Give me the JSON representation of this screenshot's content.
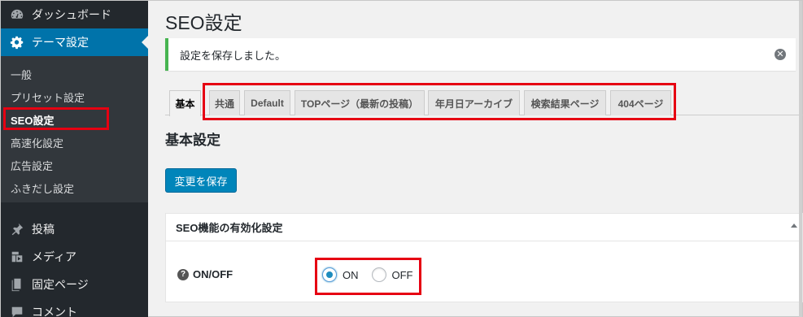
{
  "sidebar": {
    "top_items": [
      {
        "label": "ダッシュボード",
        "icon": "dashboard-icon"
      },
      {
        "label": "テーマ設定",
        "icon": "gear-icon"
      },
      {
        "label": "投稿",
        "icon": "pin-icon"
      },
      {
        "label": "メディア",
        "icon": "media-icon"
      },
      {
        "label": "固定ページ",
        "icon": "page-icon"
      },
      {
        "label": "コメント",
        "icon": "comment-icon"
      }
    ],
    "submenu": [
      "一般",
      "プリセット設定",
      "SEO設定",
      "高速化設定",
      "広告設定",
      "ふきだし設定"
    ],
    "active_submenu": "SEO設定"
  },
  "page": {
    "title": "SEO設定",
    "notice": "設定を保存しました。",
    "dismiss_icon": "✕",
    "tabs": [
      "基本",
      "共通",
      "Default",
      "TOPページ（最新の投稿）",
      "年月日アーカイブ",
      "検索結果ページ",
      "404ページ"
    ],
    "active_tab": "基本",
    "section_title": "基本設定",
    "save_button": "変更を保存",
    "postbox": {
      "title": "SEO機能の有効化設定",
      "field_label": "ON/OFF",
      "help_icon": "?",
      "options": [
        {
          "label": "ON",
          "checked": true
        },
        {
          "label": "OFF",
          "checked": false
        }
      ]
    }
  },
  "colors": {
    "sidebar_bg": "#23282d",
    "submenu_bg": "#32373c",
    "accent": "#0073aa",
    "primary_button": "#0085ba",
    "notice_success": "#46b450",
    "highlight_box": "#e60012"
  }
}
